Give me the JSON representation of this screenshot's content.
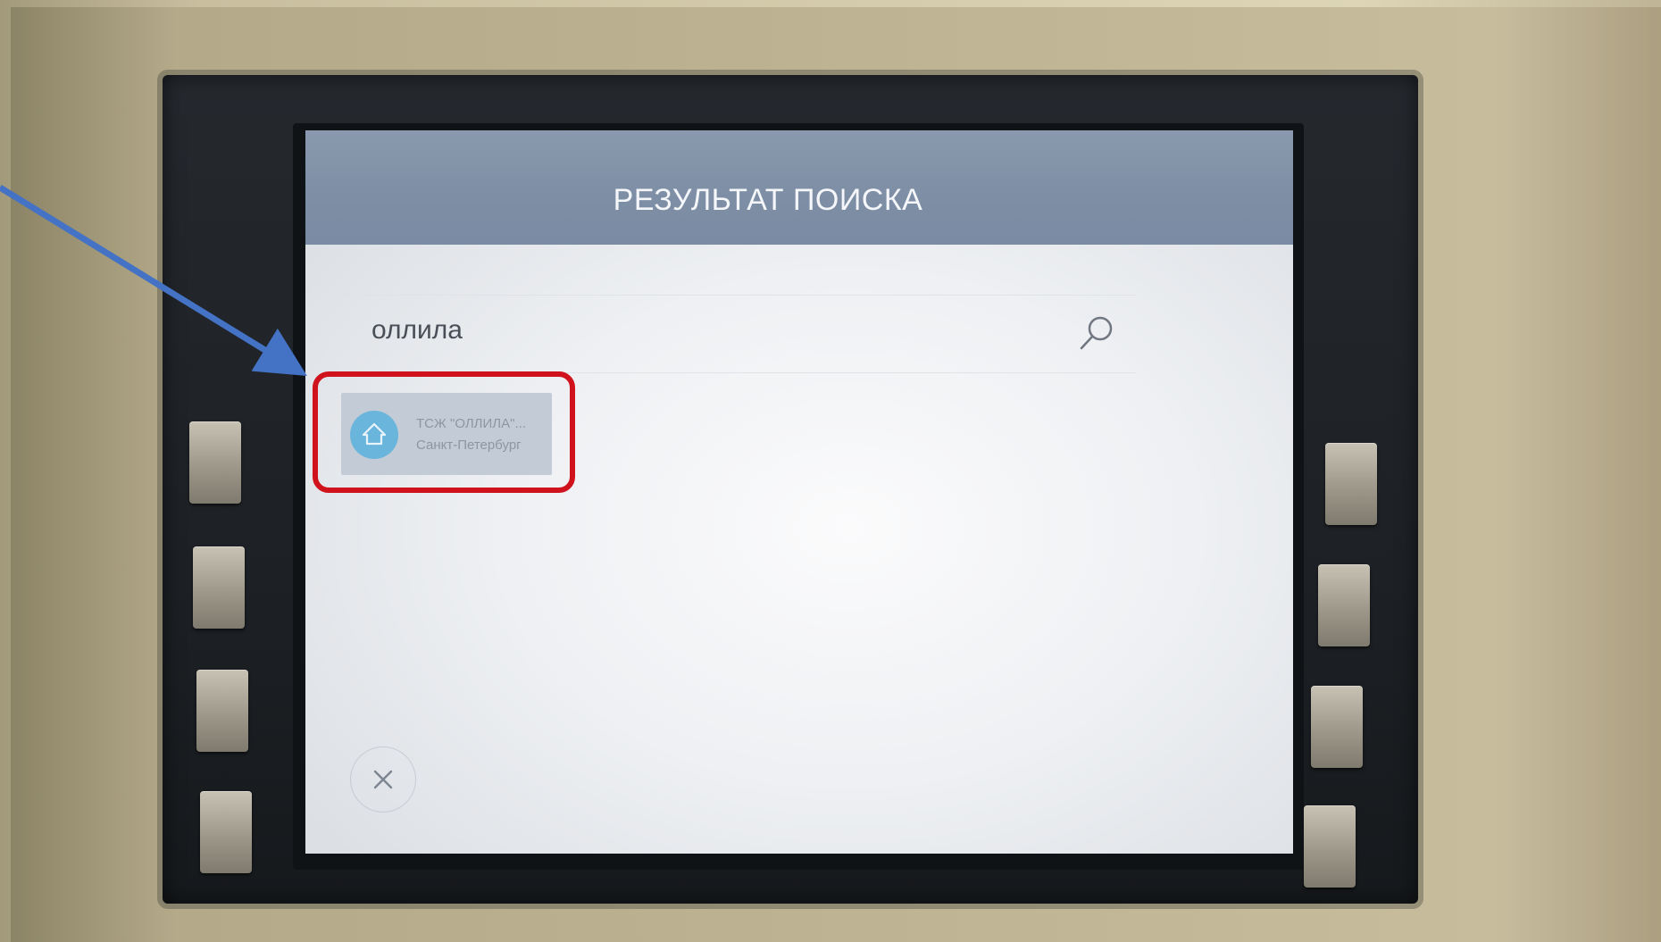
{
  "screen": {
    "header_title": "РЕЗУЛЬТАТ ПОИСКА",
    "search": {
      "query": "оллила",
      "icon": "search-icon"
    },
    "results": [
      {
        "name": "ТСЖ \"ОЛЛИЛА\"...",
        "city": "Санкт-Петербург",
        "icon": "house-icon"
      }
    ],
    "close_icon": "close-icon"
  },
  "annotation": {
    "arrow_color": "#4472c4",
    "highlight_color": "#d0121c"
  },
  "colors": {
    "header_bg": "#7d8ea5",
    "avatar_bg": "#6ab5dc"
  }
}
